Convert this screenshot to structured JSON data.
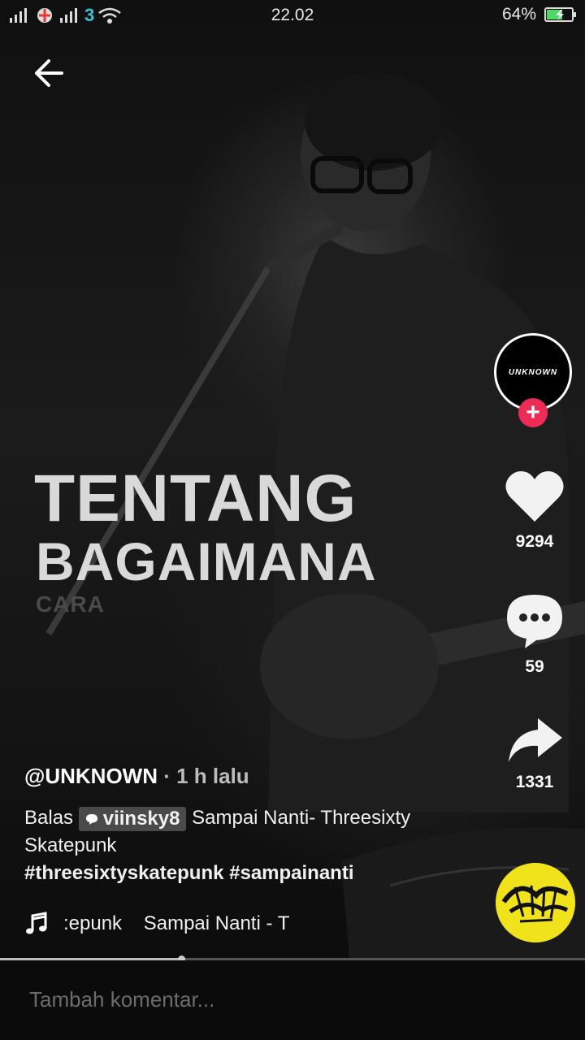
{
  "status_bar": {
    "time": "22.02",
    "battery_percent": "64%",
    "carrier_label": "3",
    "battery_level": 0.64,
    "icons": [
      "signal-icon",
      "data-carrier-icon",
      "signal-icon",
      "wifi-icon",
      "battery-charging-icon"
    ]
  },
  "header": {
    "back_icon": "arrow-left-icon"
  },
  "video": {
    "overlay_line1": "TENTANG",
    "overlay_line2": "BAGAIMANA",
    "overlay_line3": "CARA"
  },
  "creator": {
    "avatar_text": "UNKNOWN",
    "follow_symbol": "+"
  },
  "actions": {
    "likes": "9294",
    "comments": "59",
    "shares": "1331"
  },
  "post": {
    "author": "@UNKNOWN",
    "time_ago": " · 1 h lalu",
    "reply_prefix": "Balas",
    "mention": "viinsky8",
    "caption_text": " Sampai Nanti- Threesixty Skatepunk",
    "hashtags": "#threesixtyskatepunk #sampainanti"
  },
  "music": {
    "scrolling_text": ":epunk    Sampai Nanti - T",
    "icon": "music-note-icon"
  },
  "playback": {
    "progress": 0.31
  },
  "comment": {
    "placeholder": "Tambah komentar..."
  },
  "colors": {
    "accent": "#ee2b55",
    "carrier": "#39c3d8",
    "battery": "#4cd964",
    "disc": "#f1e31b"
  }
}
